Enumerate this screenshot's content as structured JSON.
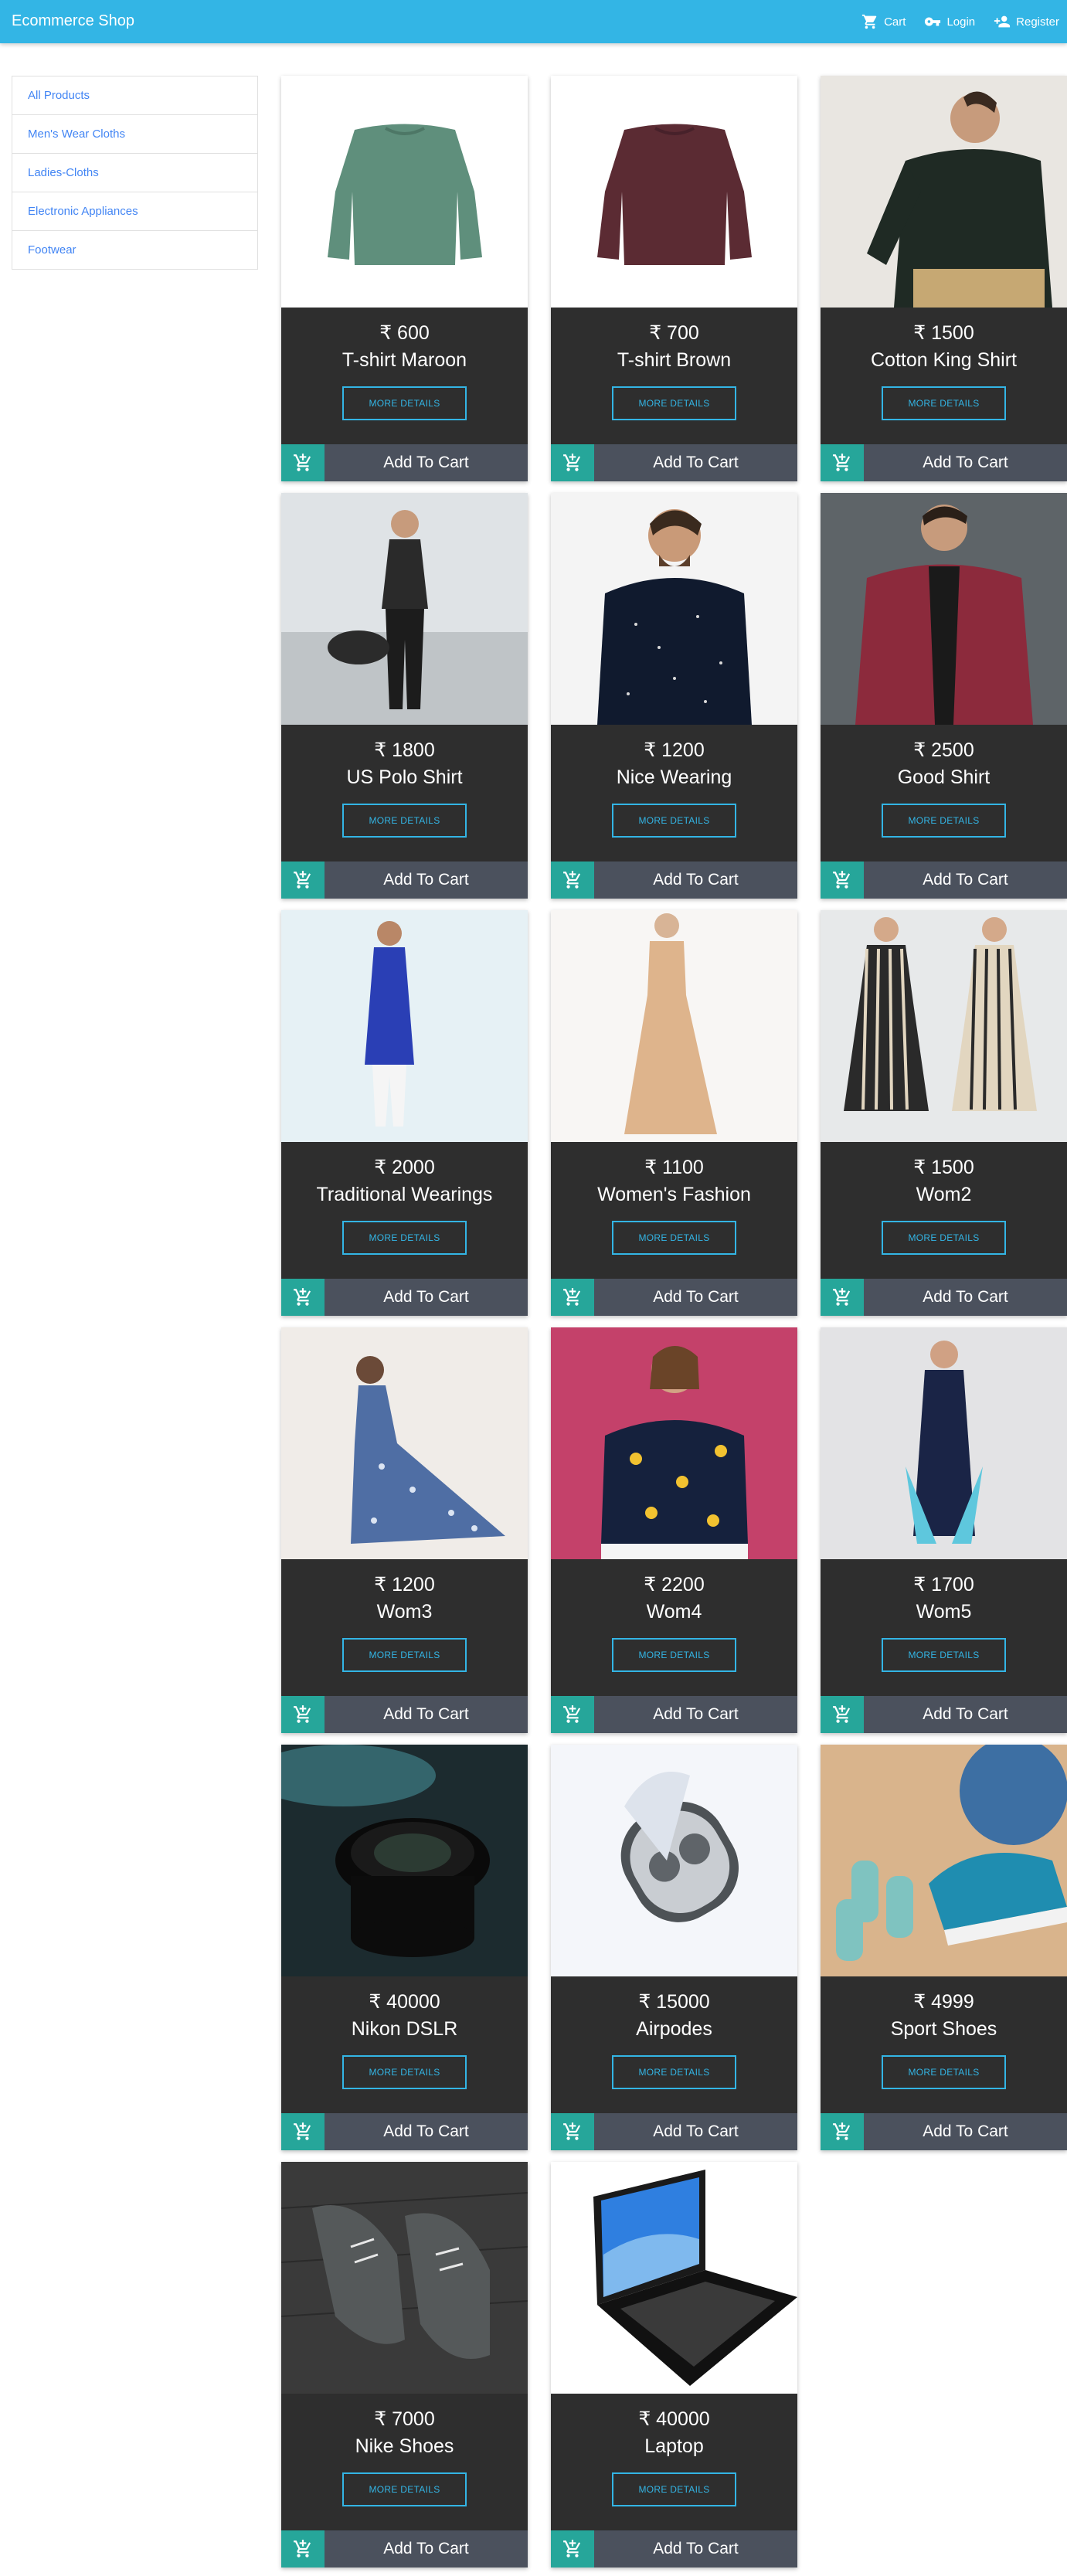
{
  "nav": {
    "brand": "Ecommerce Shop",
    "cart": "Cart",
    "login": "Login",
    "register": "Register"
  },
  "sidebar": {
    "items": [
      {
        "label": "All Products"
      },
      {
        "label": "Men's Wear Cloths"
      },
      {
        "label": "Ladies-Cloths"
      },
      {
        "label": "Electronic Appliances"
      },
      {
        "label": "Footwear"
      }
    ]
  },
  "products": [
    {
      "price": "₹ 600",
      "title": "T-shirt Maroon",
      "image": "green-sweater"
    },
    {
      "price": "₹ 700",
      "title": "T-shirt Brown",
      "image": "maroon-sweater"
    },
    {
      "price": "₹ 1500",
      "title": "Cotton King Shirt",
      "image": "man-black-sweater"
    },
    {
      "price": "₹ 1800",
      "title": "US Polo Shirt",
      "image": "man-with-bag"
    },
    {
      "price": "₹ 1200",
      "title": "Nice Wearing",
      "image": "man-dotted-shirt"
    },
    {
      "price": "₹ 2500",
      "title": "Good Shirt",
      "image": "man-red-blazer"
    },
    {
      "price": "₹ 2000",
      "title": "Traditional Wearings",
      "image": "man-blue-kurta"
    },
    {
      "price": "₹ 1100",
      "title": "Women's Fashion",
      "image": "beige-dress"
    },
    {
      "price": "₹ 1500",
      "title": "Wom2",
      "image": "striped-dresses"
    },
    {
      "price": "₹ 1200",
      "title": "Wom3",
      "image": "blue-floral-dress"
    },
    {
      "price": "₹ 2200",
      "title": "Wom4",
      "image": "navy-printed-top"
    },
    {
      "price": "₹ 1700",
      "title": "Wom5",
      "image": "navy-kurta"
    },
    {
      "price": "₹ 40000",
      "title": "Nikon DSLR",
      "image": "camera-lens"
    },
    {
      "price": "₹ 15000",
      "title": "Airpodes",
      "image": "earbuds-case"
    },
    {
      "price": "₹ 4999",
      "title": "Sport Shoes",
      "image": "sport-shoes-dumbbells"
    },
    {
      "price": "₹ 7000",
      "title": "Nike Shoes",
      "image": "grey-sneakers"
    },
    {
      "price": "₹ 40000",
      "title": "Laptop",
      "image": "laptop"
    }
  ],
  "labels": {
    "more_details": "MORE DETAILS",
    "add_to_cart": "Add To Cart"
  },
  "icons": {
    "cart": "cart-icon",
    "login": "key-icon",
    "register": "user-plus-icon",
    "add": "cart-plus-icon"
  },
  "colors": {
    "navbar": "#33b5e5",
    "card_body": "#2e2e2e",
    "cart_bar": "#4b515d",
    "cart_icon_bg": "#26a69a",
    "link": "#4285f4"
  }
}
